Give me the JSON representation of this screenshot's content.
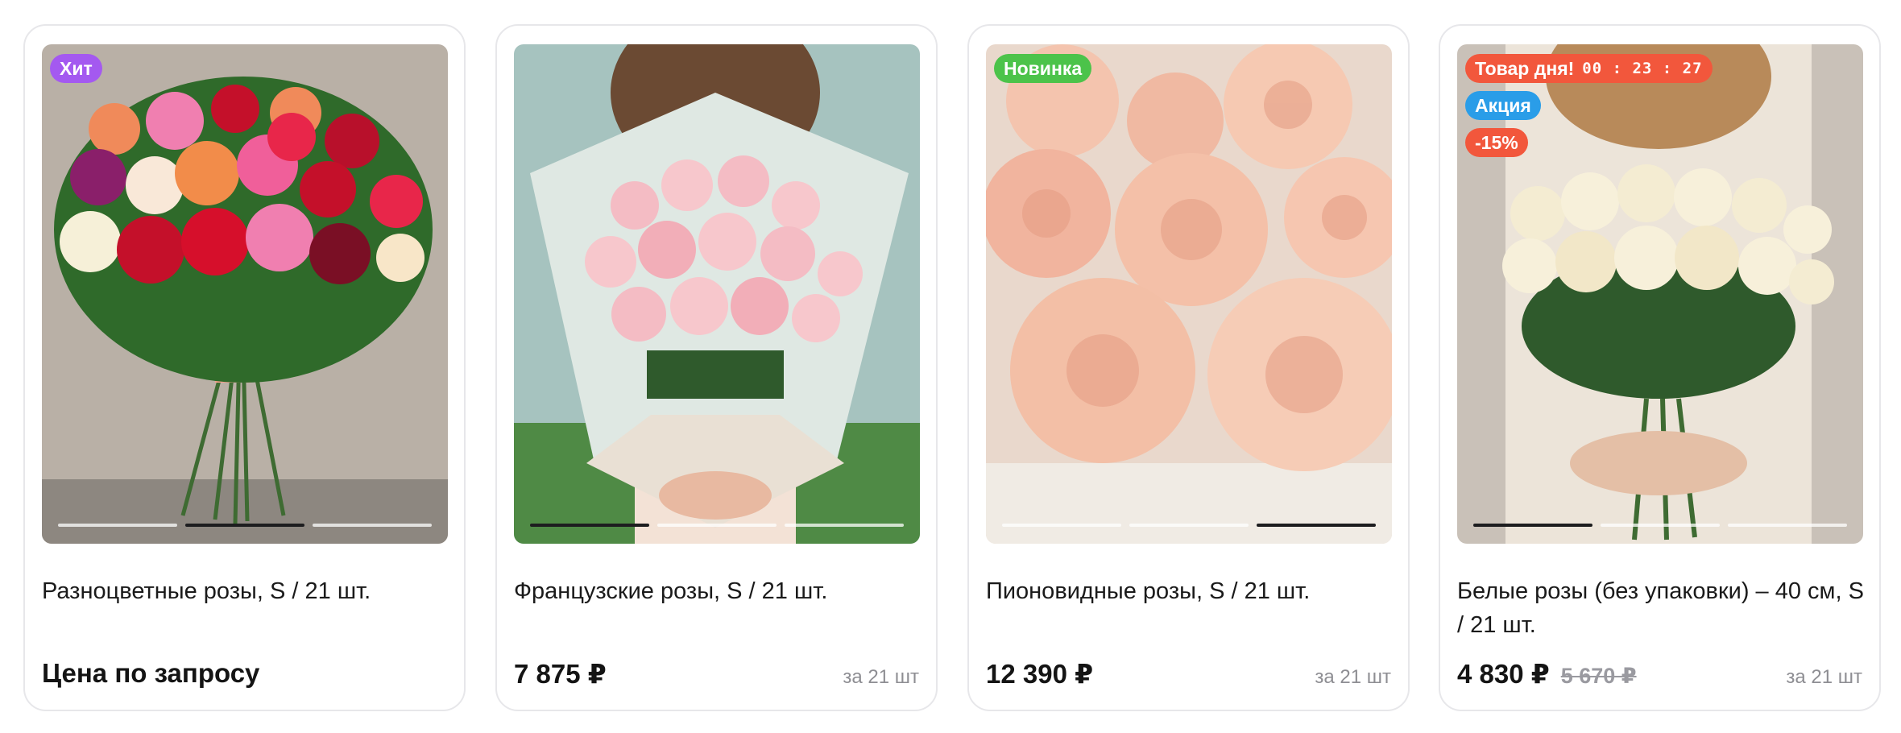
{
  "products": [
    {
      "title": "Разноцветные розы, S / 21 шт.",
      "price": "Цена по запросу",
      "badges": [
        "Хит"
      ],
      "image": "multicolor-roses-bouquet",
      "slides": 3,
      "active_slide": 2
    },
    {
      "title": "Французские розы, S / 21 шт.",
      "price": "7 875 ₽",
      "per": "за 21 шт",
      "image": "pink-french-roses-bouquet",
      "slides": 3,
      "active_slide": 1
    },
    {
      "title": "Пионовидные розы, S / 21 шт.",
      "price": "12 390 ₽",
      "per": "за 21 шт",
      "badges": [
        "Новинка"
      ],
      "image": "peony-roses-closeup",
      "slides": 3,
      "active_slide": 3
    },
    {
      "title": "Белые розы (без упаковки) – 40 см, S / 21 шт.",
      "price": "4 830 ₽",
      "old_price": "5 670 ₽",
      "per": "за 21 шт",
      "badges": [
        "Товар дня!",
        "Акция",
        "-15%"
      ],
      "timer": "00 : 23 : 27",
      "image": "white-roses-bouquet",
      "slides": 3,
      "active_slide": 1
    }
  ],
  "colors": {
    "badge_hit": "#a459f0",
    "badge_new": "#4cc34a",
    "badge_day": "#f2573c",
    "badge_promo": "#2a9de8",
    "badge_discount": "#f2573c"
  }
}
